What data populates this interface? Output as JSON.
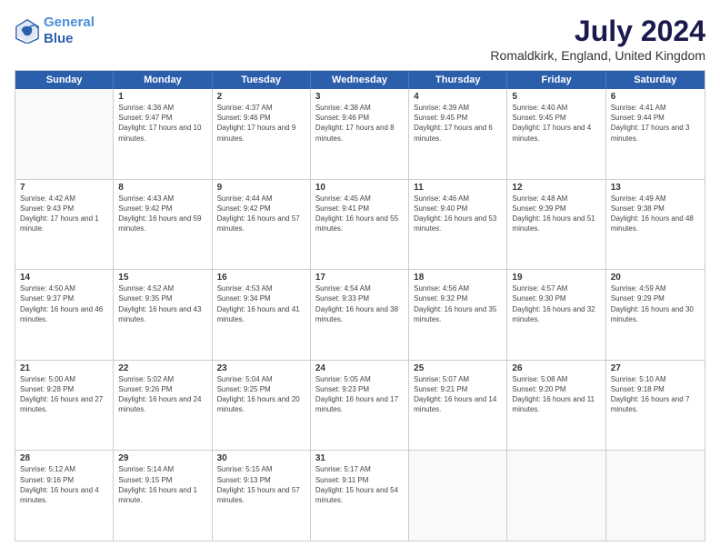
{
  "header": {
    "logo_line1": "General",
    "logo_line2": "Blue",
    "month": "July 2024",
    "location": "Romaldkirk, England, United Kingdom"
  },
  "weekdays": [
    "Sunday",
    "Monday",
    "Tuesday",
    "Wednesday",
    "Thursday",
    "Friday",
    "Saturday"
  ],
  "rows": [
    [
      {
        "day": "",
        "sunrise": "",
        "sunset": "",
        "daylight": ""
      },
      {
        "day": "1",
        "sunrise": "Sunrise: 4:36 AM",
        "sunset": "Sunset: 9:47 PM",
        "daylight": "Daylight: 17 hours and 10 minutes."
      },
      {
        "day": "2",
        "sunrise": "Sunrise: 4:37 AM",
        "sunset": "Sunset: 9:46 PM",
        "daylight": "Daylight: 17 hours and 9 minutes."
      },
      {
        "day": "3",
        "sunrise": "Sunrise: 4:38 AM",
        "sunset": "Sunset: 9:46 PM",
        "daylight": "Daylight: 17 hours and 8 minutes."
      },
      {
        "day": "4",
        "sunrise": "Sunrise: 4:39 AM",
        "sunset": "Sunset: 9:45 PM",
        "daylight": "Daylight: 17 hours and 6 minutes."
      },
      {
        "day": "5",
        "sunrise": "Sunrise: 4:40 AM",
        "sunset": "Sunset: 9:45 PM",
        "daylight": "Daylight: 17 hours and 4 minutes."
      },
      {
        "day": "6",
        "sunrise": "Sunrise: 4:41 AM",
        "sunset": "Sunset: 9:44 PM",
        "daylight": "Daylight: 17 hours and 3 minutes."
      }
    ],
    [
      {
        "day": "7",
        "sunrise": "Sunrise: 4:42 AM",
        "sunset": "Sunset: 9:43 PM",
        "daylight": "Daylight: 17 hours and 1 minute."
      },
      {
        "day": "8",
        "sunrise": "Sunrise: 4:43 AM",
        "sunset": "Sunset: 9:42 PM",
        "daylight": "Daylight: 16 hours and 59 minutes."
      },
      {
        "day": "9",
        "sunrise": "Sunrise: 4:44 AM",
        "sunset": "Sunset: 9:42 PM",
        "daylight": "Daylight: 16 hours and 57 minutes."
      },
      {
        "day": "10",
        "sunrise": "Sunrise: 4:45 AM",
        "sunset": "Sunset: 9:41 PM",
        "daylight": "Daylight: 16 hours and 55 minutes."
      },
      {
        "day": "11",
        "sunrise": "Sunrise: 4:46 AM",
        "sunset": "Sunset: 9:40 PM",
        "daylight": "Daylight: 16 hours and 53 minutes."
      },
      {
        "day": "12",
        "sunrise": "Sunrise: 4:48 AM",
        "sunset": "Sunset: 9:39 PM",
        "daylight": "Daylight: 16 hours and 51 minutes."
      },
      {
        "day": "13",
        "sunrise": "Sunrise: 4:49 AM",
        "sunset": "Sunset: 9:38 PM",
        "daylight": "Daylight: 16 hours and 48 minutes."
      }
    ],
    [
      {
        "day": "14",
        "sunrise": "Sunrise: 4:50 AM",
        "sunset": "Sunset: 9:37 PM",
        "daylight": "Daylight: 16 hours and 46 minutes."
      },
      {
        "day": "15",
        "sunrise": "Sunrise: 4:52 AM",
        "sunset": "Sunset: 9:35 PM",
        "daylight": "Daylight: 16 hours and 43 minutes."
      },
      {
        "day": "16",
        "sunrise": "Sunrise: 4:53 AM",
        "sunset": "Sunset: 9:34 PM",
        "daylight": "Daylight: 16 hours and 41 minutes."
      },
      {
        "day": "17",
        "sunrise": "Sunrise: 4:54 AM",
        "sunset": "Sunset: 9:33 PM",
        "daylight": "Daylight: 16 hours and 38 minutes."
      },
      {
        "day": "18",
        "sunrise": "Sunrise: 4:56 AM",
        "sunset": "Sunset: 9:32 PM",
        "daylight": "Daylight: 16 hours and 35 minutes."
      },
      {
        "day": "19",
        "sunrise": "Sunrise: 4:57 AM",
        "sunset": "Sunset: 9:30 PM",
        "daylight": "Daylight: 16 hours and 32 minutes."
      },
      {
        "day": "20",
        "sunrise": "Sunrise: 4:59 AM",
        "sunset": "Sunset: 9:29 PM",
        "daylight": "Daylight: 16 hours and 30 minutes."
      }
    ],
    [
      {
        "day": "21",
        "sunrise": "Sunrise: 5:00 AM",
        "sunset": "Sunset: 9:28 PM",
        "daylight": "Daylight: 16 hours and 27 minutes."
      },
      {
        "day": "22",
        "sunrise": "Sunrise: 5:02 AM",
        "sunset": "Sunset: 9:26 PM",
        "daylight": "Daylight: 16 hours and 24 minutes."
      },
      {
        "day": "23",
        "sunrise": "Sunrise: 5:04 AM",
        "sunset": "Sunset: 9:25 PM",
        "daylight": "Daylight: 16 hours and 20 minutes."
      },
      {
        "day": "24",
        "sunrise": "Sunrise: 5:05 AM",
        "sunset": "Sunset: 9:23 PM",
        "daylight": "Daylight: 16 hours and 17 minutes."
      },
      {
        "day": "25",
        "sunrise": "Sunrise: 5:07 AM",
        "sunset": "Sunset: 9:21 PM",
        "daylight": "Daylight: 16 hours and 14 minutes."
      },
      {
        "day": "26",
        "sunrise": "Sunrise: 5:08 AM",
        "sunset": "Sunset: 9:20 PM",
        "daylight": "Daylight: 16 hours and 11 minutes."
      },
      {
        "day": "27",
        "sunrise": "Sunrise: 5:10 AM",
        "sunset": "Sunset: 9:18 PM",
        "daylight": "Daylight: 16 hours and 7 minutes."
      }
    ],
    [
      {
        "day": "28",
        "sunrise": "Sunrise: 5:12 AM",
        "sunset": "Sunset: 9:16 PM",
        "daylight": "Daylight: 16 hours and 4 minutes."
      },
      {
        "day": "29",
        "sunrise": "Sunrise: 5:14 AM",
        "sunset": "Sunset: 9:15 PM",
        "daylight": "Daylight: 16 hours and 1 minute."
      },
      {
        "day": "30",
        "sunrise": "Sunrise: 5:15 AM",
        "sunset": "Sunset: 9:13 PM",
        "daylight": "Daylight: 15 hours and 57 minutes."
      },
      {
        "day": "31",
        "sunrise": "Sunrise: 5:17 AM",
        "sunset": "Sunset: 9:11 PM",
        "daylight": "Daylight: 15 hours and 54 minutes."
      },
      {
        "day": "",
        "sunrise": "",
        "sunset": "",
        "daylight": ""
      },
      {
        "day": "",
        "sunrise": "",
        "sunset": "",
        "daylight": ""
      },
      {
        "day": "",
        "sunrise": "",
        "sunset": "",
        "daylight": ""
      }
    ]
  ]
}
